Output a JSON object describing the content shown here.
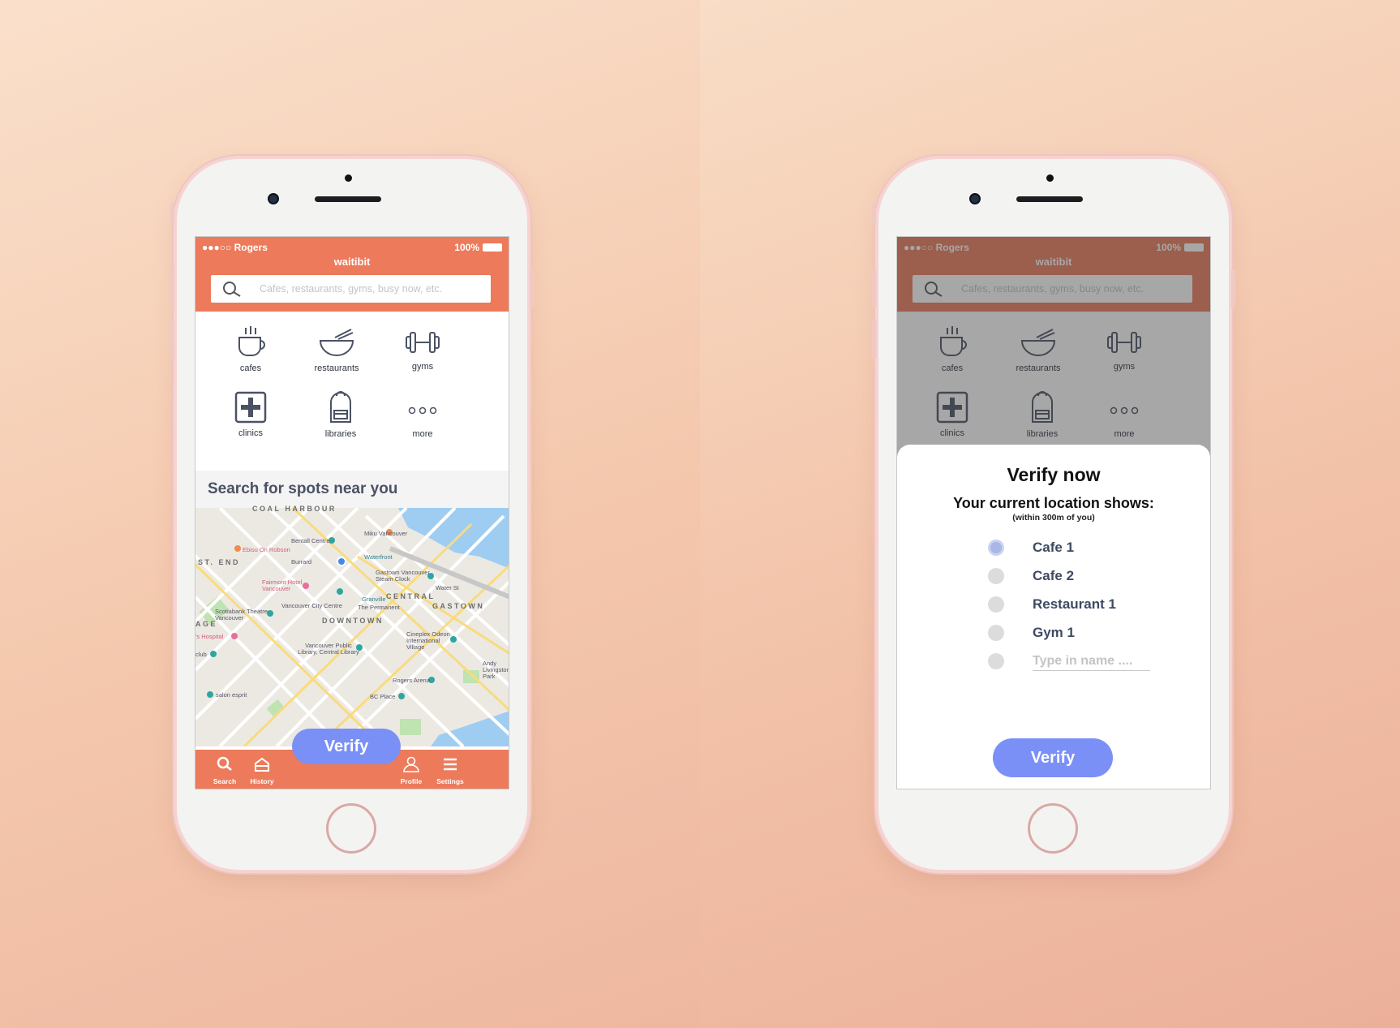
{
  "status": {
    "carrier": "●●●○○ Rogers",
    "battery": "100%"
  },
  "app": {
    "title": "waitibit"
  },
  "search": {
    "placeholder": "Cafes, restaurants, gyms, busy now, etc."
  },
  "categories": [
    {
      "label": "cafes",
      "icon": "coffee-cup-icon"
    },
    {
      "label": "restaurants",
      "icon": "bowl-icon"
    },
    {
      "label": "gyms",
      "icon": "dumbbell-icon"
    },
    {
      "label": "clinics",
      "icon": "medical-cross-icon"
    },
    {
      "label": "libraries",
      "icon": "backpack-icon"
    },
    {
      "label": "more",
      "icon": "more-dots-icon"
    }
  ],
  "near": {
    "title": "Search for spots near you"
  },
  "map": {
    "labels": [
      "Bentall Centre",
      "Miku Vancouver",
      "Ebisu On Robson",
      "Burrard",
      "Waterfront",
      "Gastown Vancouver Steam Clock",
      "Fairmont Hotel Vancouver",
      "Granville",
      "CENTRAL",
      "GASTOWN",
      "Vancouver City Centre",
      "The Permanent",
      "Scotiabank Theatre Vancouver",
      "DOWNTOWN",
      "Cineplex Odeon International Village",
      "Vancouver Public Library, Central Library",
      "Andy Livingstone Park",
      "Rogers Arena",
      "BC Place",
      "salon esprit",
      "ST. END",
      "AGE",
      "'s Hospital",
      "club",
      "Water St",
      "COAL HARBOUR"
    ]
  },
  "tabs": [
    {
      "label": "Search",
      "icon": "search-icon"
    },
    {
      "label": "History",
      "icon": "history-icon"
    },
    {
      "label": "Profile",
      "icon": "profile-icon"
    },
    {
      "label": "Settings",
      "icon": "menu-icon"
    }
  ],
  "verify": {
    "label": "Verify"
  },
  "modal": {
    "title": "Verify now",
    "subtitle": "Your current location shows:",
    "note": "(within 300m of you)",
    "options": [
      "Cafe 1",
      "Cafe 2",
      "Restaurant 1",
      "Gym 1"
    ],
    "selected_index": 0,
    "custom_placeholder": "Type in name ....",
    "verify_label": "Verify"
  },
  "colors": {
    "header": "#ec7a5b",
    "accent": "#7a90f7",
    "text_dark": "#4b5264"
  }
}
